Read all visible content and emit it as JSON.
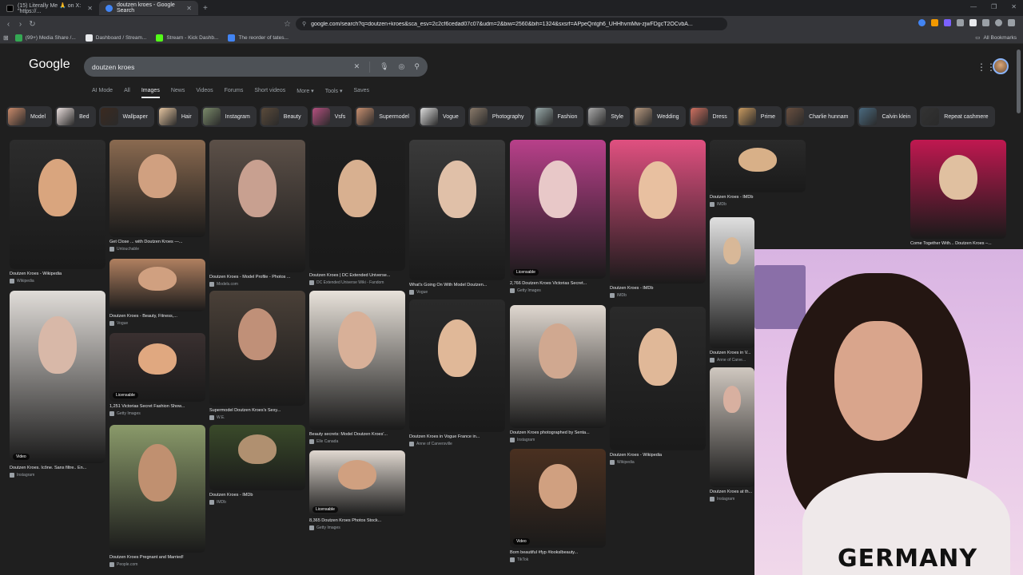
{
  "browser": {
    "tabs": [
      {
        "title": "(15) Literally Me 🙏 on X: \"https://...",
        "active": false
      },
      {
        "title": "doutzen kroes - Google Search",
        "active": true
      }
    ],
    "url": "google.com/search?q=doutzen+kroes&sca_esv=2c2cf6cedad07c07&udm=2&biw=2560&bih=1324&sxsrf=APpeQntgh6_UHHhvmMw-zjwFDgcT2OCvbA...",
    "bookmarks": [
      "(99+) Media Share /...",
      "Dashboard / Stream...",
      "Stream - Kick Dashb...",
      "The reorder of tates..."
    ],
    "all_bookmarks": "All Bookmarks"
  },
  "google": {
    "logo": "Google",
    "query": "doutzen kroes",
    "filters": [
      "AI Mode",
      "All",
      "Images",
      "News",
      "Videos",
      "Forums",
      "Short videos",
      "More ▾",
      "Tools ▾",
      "Saves"
    ],
    "active_filter": "Images",
    "chips": [
      "Model",
      "Bed",
      "Wallpaper",
      "Hair",
      "Instagram",
      "Beauty",
      "Vsfs",
      "Supermodel",
      "Vogue",
      "Photography",
      "Fashion",
      "Style",
      "Wedding",
      "Dress",
      "Prime",
      "Charlie hunnam",
      "Calvin klein",
      "Repeat cashmere"
    ]
  },
  "results": [
    {
      "caption": "Doutzen Kroes - Wikipedia",
      "source": "Wikipedia",
      "badge": ""
    },
    {
      "caption": "Get Close ... with Doutzen Kroes —...",
      "source": "Untouchable",
      "badge": ""
    },
    {
      "caption": "Doutzen Kroes - Model Profile - Photos ...",
      "source": "Models.com",
      "badge": ""
    },
    {
      "caption": "Doutzen Kroes | DC Extended Universe...",
      "source": "DC Extended Universe Wiki - Fandom",
      "badge": ""
    },
    {
      "caption": "What's Going On With Model Doutzen...",
      "source": "Vogue",
      "badge": ""
    },
    {
      "caption": "2,766 Doutzen Kroes Victorias Secret...",
      "source": "Getty Images",
      "badge": "Licensable"
    },
    {
      "caption": "Doutzen Kroes - IMDb",
      "source": "IMDb",
      "badge": ""
    },
    {
      "caption": "Doutzen Kroes - IMDb",
      "source": "IMDb",
      "badge": ""
    },
    {
      "caption": "Come Together With... Doutzen Kroes –...",
      "source": "",
      "badge": ""
    },
    {
      "caption": "Doutzen Kroes - Beauty, Fitness,...",
      "source": "Vogue",
      "badge": ""
    },
    {
      "caption": "1,251 Victorias Secret Fashion Show...",
      "source": "Getty Images",
      "badge": "Licensable"
    },
    {
      "caption": "Supermodel Doutzen Kroes's Sexy...",
      "source": "W.E.",
      "badge": ""
    },
    {
      "caption": "Beauty secrets: Model Doutzen Kroes'...",
      "source": "Elle Canada",
      "badge": ""
    },
    {
      "caption": "Doutzen Kroes in Vogue France in...",
      "source": "Anne of Carversville",
      "badge": ""
    },
    {
      "caption": "Doutzen Kroes photographed by Senta...",
      "source": "Instagram",
      "badge": ""
    },
    {
      "caption": "Doutzen Kroes - Wikipedia",
      "source": "Wikipedia",
      "badge": ""
    },
    {
      "caption": "Doutzen Kroes. Icône. Sans filtre.. En...",
      "source": "Instagram",
      "badge": "Video"
    },
    {
      "caption": "Doutzen Kroes Pregnant and Married!",
      "source": "People.com",
      "badge": ""
    },
    {
      "caption": "Doutzen Kroes - IMDb",
      "source": "IMDb",
      "badge": ""
    },
    {
      "caption": "8,365 Doutzen Kroes Photos Stock...",
      "source": "Getty Images",
      "badge": "Licensable"
    },
    {
      "caption": "Born beautiful #fyp #lookslbeauty...",
      "source": "TikTok",
      "badge": "Video"
    },
    {
      "caption": "Doutzen Kroes in V...",
      "source": "Anne of Carve...",
      "badge": ""
    },
    {
      "caption": "Doutzen Kroes at th...",
      "source": "Instagram",
      "badge": ""
    }
  ],
  "webcam": {
    "shirt_text": "GERMANY"
  },
  "colors": {
    "background": "#1f1f1f",
    "accent": "#8ab4f8"
  }
}
